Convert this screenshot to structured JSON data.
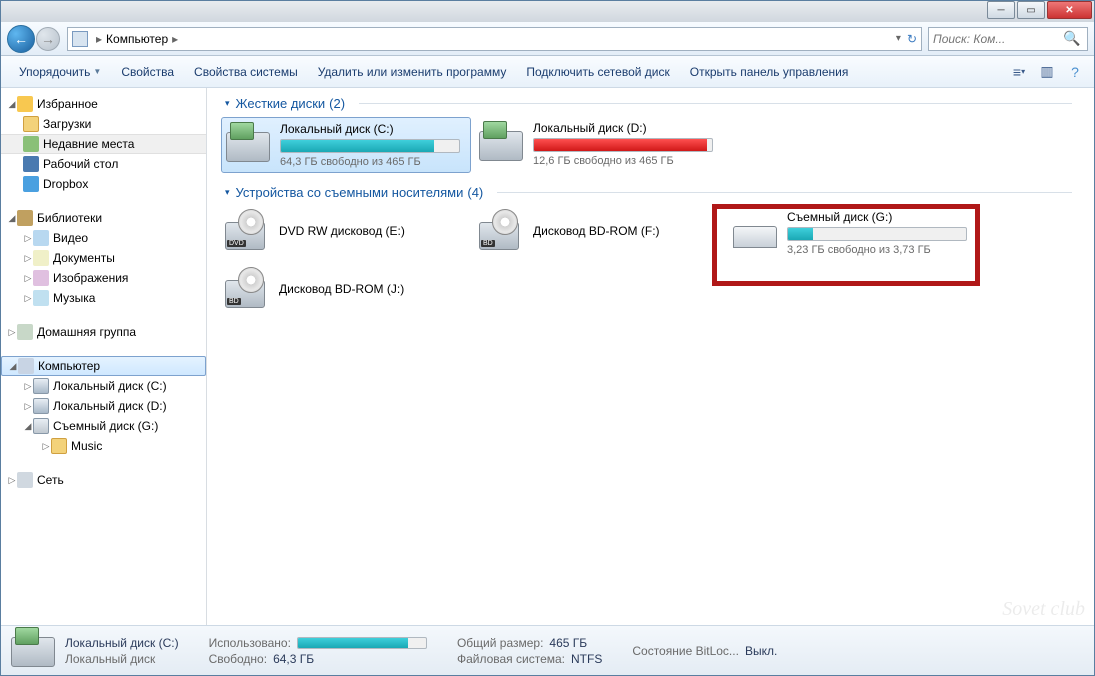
{
  "address": {
    "location": "Компьютер"
  },
  "search": {
    "placeholder": "Поиск: Ком..."
  },
  "toolbar": {
    "organize": "Упорядочить",
    "properties": "Свойства",
    "sys_properties": "Свойства системы",
    "uninstall": "Удалить или изменить программу",
    "map_drive": "Подключить сетевой диск",
    "control_panel": "Открыть панель управления"
  },
  "sidebar": {
    "favorites": "Избранное",
    "downloads": "Загрузки",
    "recent": "Недавние места",
    "desktop": "Рабочий стол",
    "dropbox": "Dropbox",
    "libraries": "Библиотеки",
    "videos": "Видео",
    "documents": "Документы",
    "pictures": "Изображения",
    "music": "Музыка",
    "homegroup": "Домашняя группа",
    "computer": "Компьютер",
    "disk_c": "Локальный диск (C:)",
    "disk_d": "Локальный диск (D:)",
    "disk_g": "Съемный диск (G:)",
    "music_folder": "Music",
    "network": "Сеть"
  },
  "groups": {
    "hdd": {
      "title": "Жесткие диски",
      "count": "(2)"
    },
    "removable": {
      "title": "Устройства со съемными носителями",
      "count": "(4)"
    }
  },
  "drives": {
    "c": {
      "name": "Локальный диск (C:)",
      "free": "64,3 ГБ свободно из 465 ГБ",
      "fill_pct": 86
    },
    "d": {
      "name": "Локальный диск (D:)",
      "free": "12,6 ГБ свободно из 465 ГБ",
      "fill_pct": 97
    },
    "e": {
      "name": "DVD RW дисковод (E:)",
      "badge": "DVD"
    },
    "f": {
      "name": "Дисковод BD-ROM (F:)",
      "badge": "BD"
    },
    "j": {
      "name": "Дисковод BD-ROM (J:)",
      "badge": "BD"
    },
    "g": {
      "name": "Съемный диск (G:)",
      "free": "3,23 ГБ свободно из 3,73 ГБ",
      "fill_pct": 14
    }
  },
  "status": {
    "name": "Локальный диск (C:)",
    "type": "Локальный диск",
    "used_label": "Использовано:",
    "used_pct": 86,
    "free_label": "Свободно:",
    "free_val": "64,3 ГБ",
    "total_label": "Общий размер:",
    "total_val": "465 ГБ",
    "fs_label": "Файловая система:",
    "fs_val": "NTFS",
    "bitlocker_label": "Состояние BitLoc...",
    "bitlocker_val": "Выкл."
  },
  "watermark": "Sovet club"
}
